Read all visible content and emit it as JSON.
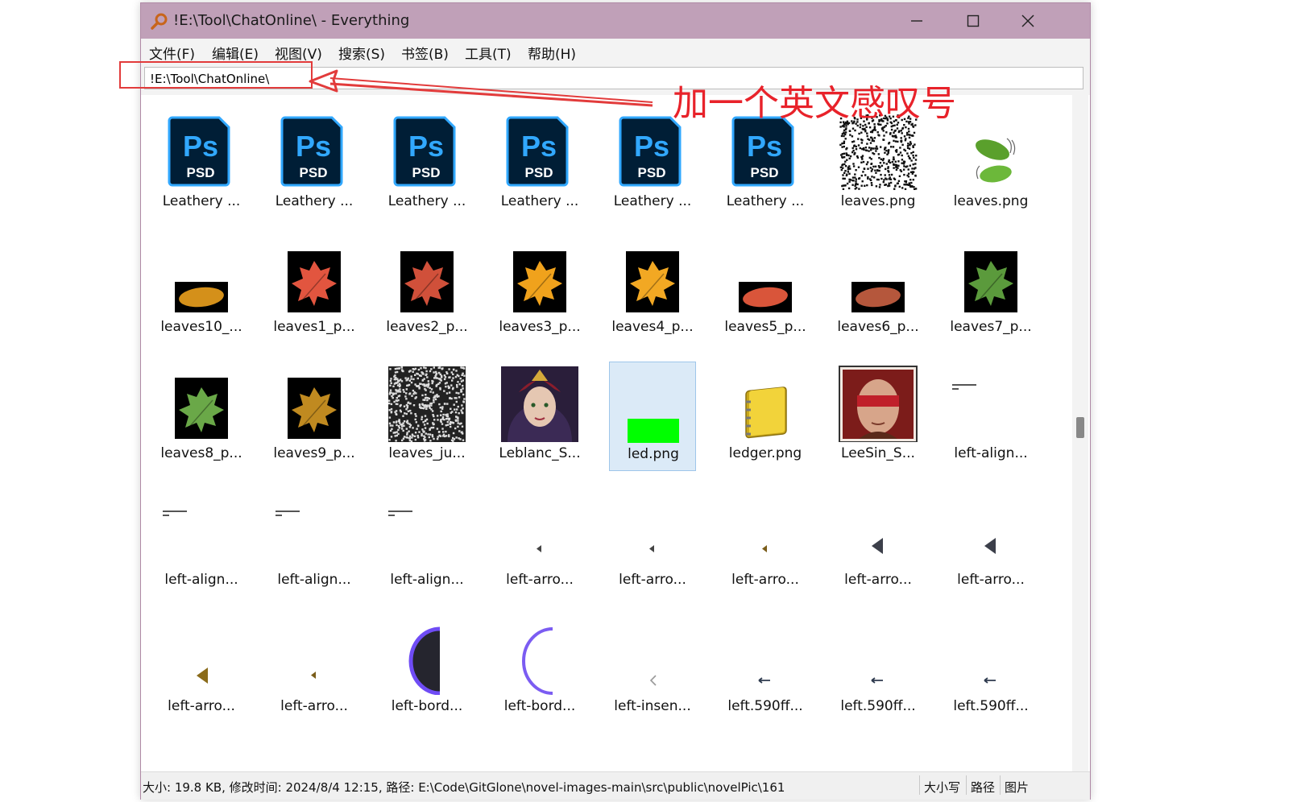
{
  "window": {
    "title": "!E:\\Tool\\ChatOnline\\ - Everything",
    "app_icon": "magnifier-icon",
    "buttons": [
      "minimize-icon",
      "maximize-icon",
      "close-icon"
    ]
  },
  "menu": [
    "文件(F)",
    "编辑(E)",
    "视图(V)",
    "搜索(S)",
    "书签(B)",
    "工具(T)",
    "帮助(H)"
  ],
  "search": {
    "value": "!E:\\Tool\\ChatOnline\\"
  },
  "annotation": {
    "text": "加一个英文感叹号",
    "color": "#e8222a"
  },
  "files": [
    {
      "label": "Leathery ...",
      "kind": "psd"
    },
    {
      "label": "Leathery ...",
      "kind": "psd"
    },
    {
      "label": "Leathery ...",
      "kind": "psd"
    },
    {
      "label": "Leathery ...",
      "kind": "psd"
    },
    {
      "label": "Leathery ...",
      "kind": "psd"
    },
    {
      "label": "Leathery ...",
      "kind": "psd"
    },
    {
      "label": "leaves.png",
      "kind": "noise"
    },
    {
      "label": "leaves.png",
      "kind": "green-leaves"
    },
    {
      "label": "leaves10_...",
      "kind": "leaf-small",
      "color": "#d4901a"
    },
    {
      "label": "leaves1_p...",
      "kind": "leaf",
      "color": "#e2553f"
    },
    {
      "label": "leaves2_p...",
      "kind": "leaf",
      "color": "#d0503a"
    },
    {
      "label": "leaves3_p...",
      "kind": "leaf",
      "color": "#f0a21c"
    },
    {
      "label": "leaves4_p...",
      "kind": "leaf",
      "color": "#f2a823"
    },
    {
      "label": "leaves5_p...",
      "kind": "leaf-small",
      "color": "#d9553a"
    },
    {
      "label": "leaves6_p...",
      "kind": "leaf-small",
      "color": "#b5573c"
    },
    {
      "label": "leaves7_p...",
      "kind": "leaf",
      "color": "#5b9a3c"
    },
    {
      "label": "leaves8_p...",
      "kind": "leaf",
      "color": "#6aa848"
    },
    {
      "label": "leaves9_p...",
      "kind": "leaf",
      "color": "#c08a20"
    },
    {
      "label": "leaves_ju...",
      "kind": "noise-dark"
    },
    {
      "label": "Leblanc_S...",
      "kind": "portrait-leblanc"
    },
    {
      "label": "led.png",
      "kind": "led",
      "selected": true
    },
    {
      "label": "ledger.png",
      "kind": "ledger"
    },
    {
      "label": "LeeSin_S...",
      "kind": "portrait-leesin"
    },
    {
      "label": "left-align...",
      "kind": "tiny-text"
    },
    {
      "label": "left-align...",
      "kind": "tiny-text"
    },
    {
      "label": "left-align...",
      "kind": "tiny-text"
    },
    {
      "label": "left-align...",
      "kind": "tiny-text"
    },
    {
      "label": "left-arro...",
      "kind": "tri-tiny",
      "color": "#444"
    },
    {
      "label": "left-arro...",
      "kind": "tri-tiny",
      "color": "#444"
    },
    {
      "label": "left-arro...",
      "kind": "tri-tiny",
      "color": "#7a5d1a"
    },
    {
      "label": "left-arro...",
      "kind": "tri-mid",
      "color": "#3c3f4a"
    },
    {
      "label": "left-arro...",
      "kind": "tri-mid",
      "color": "#3c3f4a"
    },
    {
      "label": "left-arro...",
      "kind": "tri-gold",
      "color": "#8a6b1a"
    },
    {
      "label": "left-arro...",
      "kind": "tri-tiny",
      "color": "#7a5d1a"
    },
    {
      "label": "left-bord...",
      "kind": "border-filled"
    },
    {
      "label": "left-bord...",
      "kind": "border-arc"
    },
    {
      "label": "left-insen...",
      "kind": "chevron"
    },
    {
      "label": "left.590ff...",
      "kind": "arrow-line"
    },
    {
      "label": "left.590ff...",
      "kind": "arrow-line"
    },
    {
      "label": "left.590ff...",
      "kind": "arrow-line"
    }
  ],
  "status": {
    "text": "大小: 19.8 KB, 修改时间: 2024/8/4 12:15, 路径: E:\\Code\\GitGlone\\novel-images-main\\src\\public\\novelPic\\161",
    "right": [
      "大小写",
      "路径",
      "图片"
    ]
  },
  "colors": {
    "titlebar": "#c0a0b8",
    "selection": "#dbeaf7",
    "psd_blue": "#31a8ff",
    "psd_dark": "#001e36"
  }
}
